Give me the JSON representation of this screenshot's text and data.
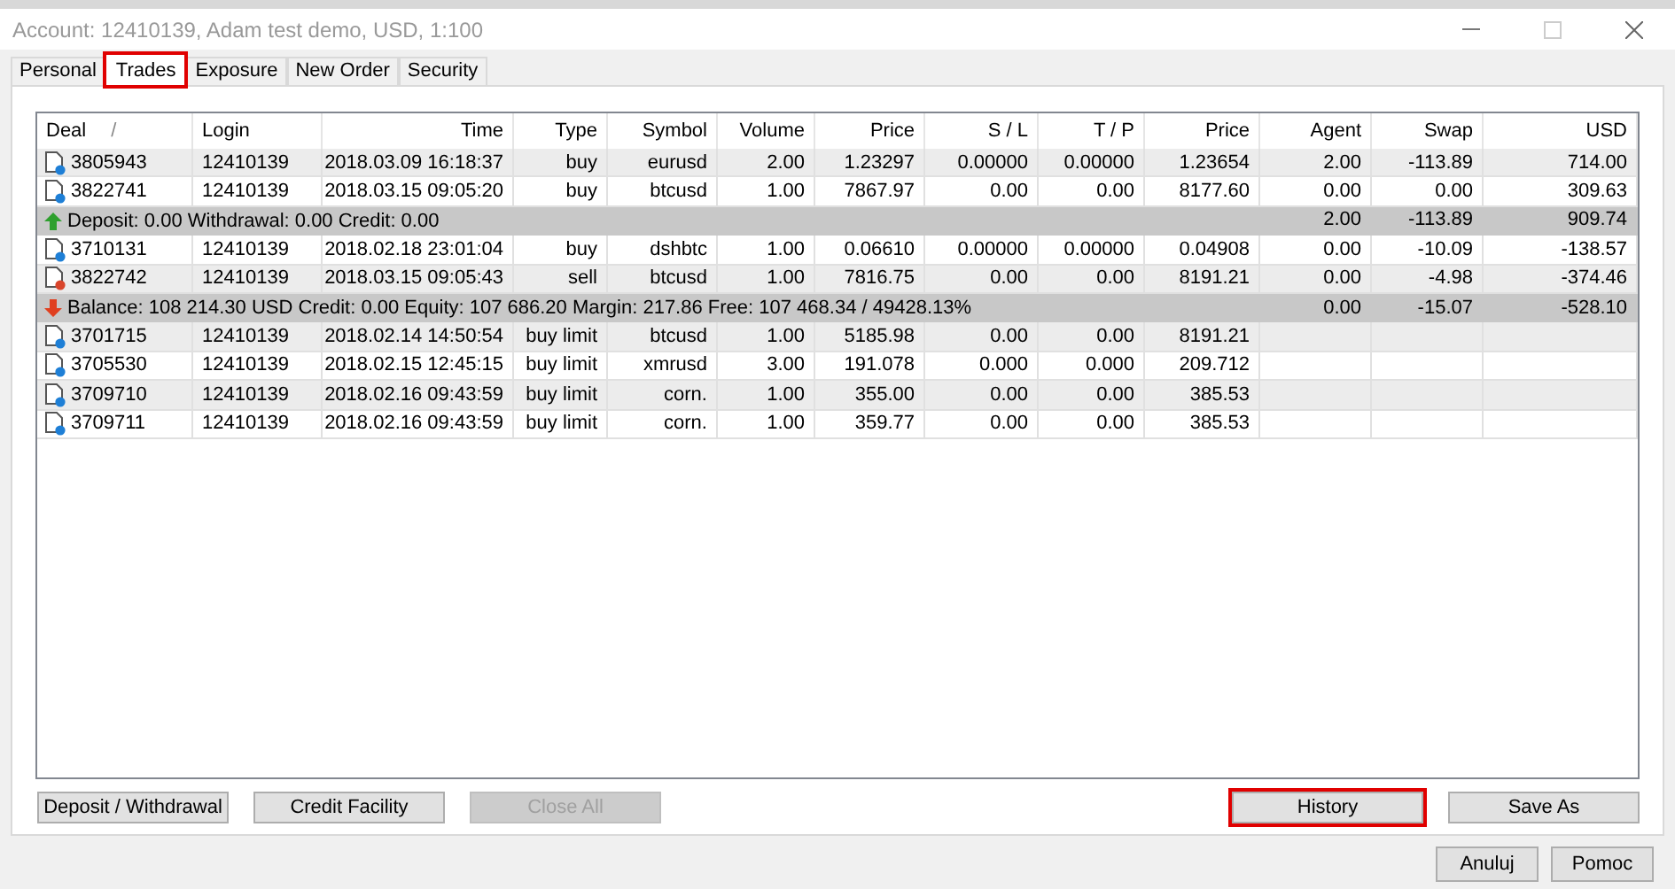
{
  "window": {
    "title": "Account: 12410139, Adam test demo, USD, 1:100"
  },
  "tabs": [
    {
      "label": "Personal",
      "selected": false,
      "highlighted": false
    },
    {
      "label": "Trades",
      "selected": true,
      "highlighted": true
    },
    {
      "label": "Exposure",
      "selected": false,
      "highlighted": false
    },
    {
      "label": "New Order",
      "selected": false,
      "highlighted": false
    },
    {
      "label": "Security",
      "selected": false,
      "highlighted": false
    }
  ],
  "table": {
    "columns": [
      {
        "label": "Deal",
        "sort": "/"
      },
      {
        "label": "Login"
      },
      {
        "label": "Time"
      },
      {
        "label": "Type"
      },
      {
        "label": "Symbol"
      },
      {
        "label": "Volume"
      },
      {
        "label": "Price"
      },
      {
        "label": "S / L"
      },
      {
        "label": "T / P"
      },
      {
        "label": "Price"
      },
      {
        "label": "Agent"
      },
      {
        "label": "Swap"
      },
      {
        "label": "USD"
      }
    ],
    "rows": [
      {
        "kind": "trade",
        "color": "#1e7fd6",
        "cells": [
          "3805943",
          "12410139",
          "2018.03.09 16:18:37",
          "buy",
          "eurusd",
          "2.00",
          "1.23297",
          "0.00000",
          "0.00000",
          "1.23654",
          "2.00",
          "-113.89",
          "714.00"
        ]
      },
      {
        "kind": "trade",
        "color": "#1e7fd6",
        "cells": [
          "3822741",
          "12410139",
          "2018.03.15 09:05:20",
          "buy",
          "btcusd",
          "1.00",
          "7867.97",
          "0.00",
          "0.00",
          "8177.60",
          "0.00",
          "0.00",
          "309.63"
        ]
      },
      {
        "kind": "deposit",
        "text": "Deposit: 0.00  Withdrawal: 0.00  Credit: 0.00",
        "values": [
          "2.00",
          "-113.89",
          "909.74"
        ]
      },
      {
        "kind": "trade",
        "color": "#1e7fd6",
        "cells": [
          "3710131",
          "12410139",
          "2018.02.18 23:01:04",
          "buy",
          "dshbtc",
          "1.00",
          "0.06610",
          "0.00000",
          "0.00000",
          "0.04908",
          "0.00",
          "-10.09",
          "-138.57"
        ]
      },
      {
        "kind": "trade",
        "color": "#d9452b",
        "cells": [
          "3822742",
          "12410139",
          "2018.03.15 09:05:43",
          "sell",
          "btcusd",
          "1.00",
          "7816.75",
          "0.00",
          "0.00",
          "8191.21",
          "0.00",
          "-4.98",
          "-374.46"
        ]
      },
      {
        "kind": "balance",
        "text": "Balance: 108 214.30 USD  Credit: 0.00  Equity: 107 686.20  Margin: 217.86  Free: 107 468.34 / 49428.13%",
        "values": [
          "0.00",
          "-15.07",
          "-528.10"
        ]
      },
      {
        "kind": "trade",
        "color": "#1e7fd6",
        "cells": [
          "3701715",
          "12410139",
          "2018.02.14 14:50:54",
          "buy limit",
          "btcusd",
          "1.00",
          "5185.98",
          "0.00",
          "0.00",
          "8191.21"
        ]
      },
      {
        "kind": "trade",
        "color": "#1e7fd6",
        "cells": [
          "3705530",
          "12410139",
          "2018.02.15 12:45:15",
          "buy limit",
          "xmrusd",
          "3.00",
          "191.078",
          "0.000",
          "0.000",
          "209.712"
        ]
      },
      {
        "kind": "trade",
        "color": "#1e7fd6",
        "cells": [
          "3709710",
          "12410139",
          "2018.02.16 09:43:59",
          "buy limit",
          "corn.",
          "1.00",
          "355.00",
          "0.00",
          "0.00",
          "385.53"
        ]
      },
      {
        "kind": "trade",
        "color": "#1e7fd6",
        "cells": [
          "3709711",
          "12410139",
          "2018.02.16 09:43:59",
          "buy limit",
          "corn.",
          "1.00",
          "359.77",
          "0.00",
          "0.00",
          "385.53"
        ]
      }
    ]
  },
  "panel_buttons_left": [
    {
      "label": "Deposit / Withdrawal",
      "disabled": false,
      "highlighted": false
    },
    {
      "label": "Credit Facility",
      "disabled": false,
      "highlighted": false
    },
    {
      "label": "Close All",
      "disabled": true,
      "highlighted": false
    }
  ],
  "panel_buttons_right": [
    {
      "label": "History",
      "disabled": false,
      "highlighted": true
    },
    {
      "label": "Save As",
      "disabled": false,
      "highlighted": false
    }
  ],
  "dialog_buttons": [
    "Anuluj",
    "Pomoc"
  ]
}
